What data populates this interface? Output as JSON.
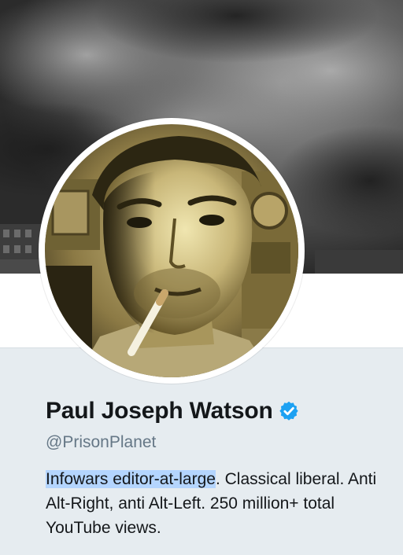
{
  "profile": {
    "display_name": "Paul Joseph Watson",
    "verified_icon": "verified-badge-icon",
    "handle": "@PrisonPlanet",
    "bio_highlighted": "Infowars editor-at-large",
    "bio_rest": ". Classical liberal. Anti Alt-Right, anti Alt-Left. 250 million+ total YouTube views."
  },
  "colors": {
    "verified_blue": "#1da1f2",
    "name_text": "#14171a",
    "handle_text": "#657786",
    "selection_highlight": "#b4d5fe",
    "page_background": "#e6ecf0"
  }
}
